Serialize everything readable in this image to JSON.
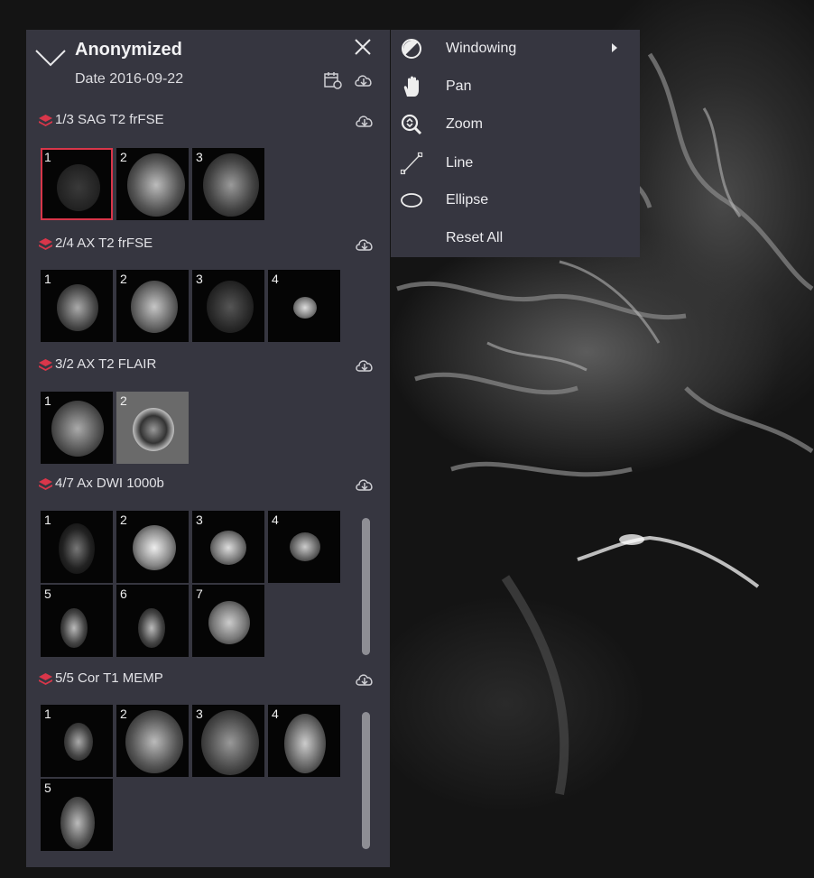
{
  "study": {
    "patient_name": "Anonymized",
    "date": "Date 2016-09-22"
  },
  "series": [
    {
      "title": "1/3 SAG T2 frFSE",
      "thumbs": [
        "1",
        "2",
        "3"
      ]
    },
    {
      "title": "2/4 AX T2 frFSE",
      "thumbs": [
        "1",
        "2",
        "3",
        "4"
      ]
    },
    {
      "title": "3/2 AX T2 FLAIR",
      "thumbs": [
        "1",
        "2"
      ]
    },
    {
      "title": "4/7 Ax DWI 1000b",
      "thumbs": [
        "1",
        "2",
        "3",
        "4",
        "5",
        "6",
        "7"
      ]
    },
    {
      "title": "5/5 Cor T1 MEMP",
      "thumbs": [
        "1",
        "2",
        "3",
        "4",
        "5"
      ]
    }
  ],
  "menu": {
    "items": [
      {
        "label": "Windowing",
        "icon": "windowing-icon",
        "has_submenu": true
      },
      {
        "label": "Pan",
        "icon": "hand-icon"
      },
      {
        "label": "Zoom",
        "icon": "zoom-icon"
      },
      {
        "label": "Line",
        "icon": "line-icon"
      },
      {
        "label": "Ellipse",
        "icon": "ellipse-icon"
      },
      {
        "label": "Reset All",
        "icon": ""
      }
    ]
  },
  "colors": {
    "panel_bg": "#363640",
    "accent_red": "#d9364a",
    "text": "#e6e6ea"
  }
}
